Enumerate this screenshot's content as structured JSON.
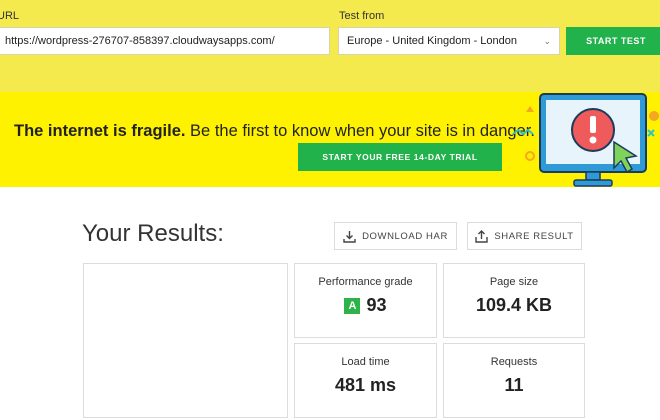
{
  "test_form": {
    "url_label": "URL",
    "url_value": "https://wordpress-276707-858397.cloudwaysapps.com/",
    "location_label": "Test from",
    "location_value": "Europe - United Kingdom - London",
    "start_label": "START TEST"
  },
  "banner": {
    "headline_bold": "The internet is fragile.",
    "headline_rest": " Be the first to know when your site is in danger.",
    "cta_label": "START YOUR FREE 14-DAY TRIAL"
  },
  "results": {
    "title": "Your Results:",
    "download_label": "DOWNLOAD HAR",
    "share_label": "SHARE RESULT",
    "metrics": {
      "performance": {
        "label": "Performance grade",
        "grade": "A",
        "value": "93"
      },
      "page_size": {
        "label": "Page size",
        "value": "109.4 KB"
      },
      "load_time": {
        "label": "Load time",
        "value": "481 ms"
      },
      "requests": {
        "label": "Requests",
        "value": "11"
      }
    }
  },
  "colors": {
    "top_bar": "#f4ea4d",
    "banner": "#fff200",
    "accent_green": "#22b24c",
    "grade_badge": "#2db34a"
  }
}
